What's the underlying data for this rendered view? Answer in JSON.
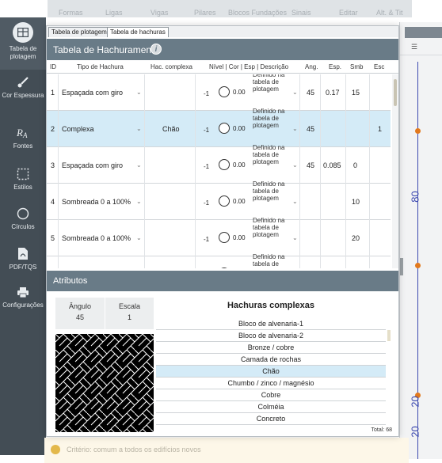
{
  "background": {
    "top_menu": [
      "Formas",
      "Ligas",
      "Vigas",
      "Pilares",
      "Blocos Fundações",
      "Sinais",
      "Editar",
      "Alt. & Tit"
    ],
    "bottom_text": "Critério: comum a todos os edifícios novos"
  },
  "sidebar": {
    "items": [
      {
        "label": "Tabela de plotagem",
        "icon": "table-icon"
      },
      {
        "label": "Cor Espessura",
        "icon": "brush-icon"
      },
      {
        "label": "Fontes",
        "icon": "font-icon"
      },
      {
        "label": "Estilos",
        "icon": "dashed-square-icon"
      },
      {
        "label": "Círculos",
        "icon": "circle-icon"
      },
      {
        "label": "PDF/TQS",
        "icon": "pdf-icon"
      },
      {
        "label": "Configurações",
        "icon": "printer-icon"
      }
    ]
  },
  "tabs": [
    {
      "label": "Tabela de plotagem",
      "active": false
    },
    {
      "label": "Tabela de hachuras",
      "active": true
    }
  ],
  "header": {
    "title": "Tabela de Hachuramento",
    "info_icon": "i"
  },
  "columns": [
    "ID",
    "Tipo de Hachura",
    "Hac. complexa",
    "Nível | Cor | Esp | Descrição",
    "Ang.",
    "Esp.",
    "Smb",
    "Esc"
  ],
  "rows": [
    {
      "id": "1",
      "tipo": "Espaçada com giro",
      "hac": "",
      "nivel": "-1",
      "esp_line": "0.00",
      "desc": "Definido na tabela de plotagem",
      "ang": "45",
      "esp": "0.17",
      "smb": "15",
      "esc": "",
      "selected": false
    },
    {
      "id": "2",
      "tipo": "Complexa",
      "hac": "Chão",
      "nivel": "-1",
      "esp_line": "0.00",
      "desc": "Definido na tabela de plotagem",
      "ang": "45",
      "esp": "",
      "smb": "",
      "esc": "1",
      "selected": true
    },
    {
      "id": "3",
      "tipo": "Espaçada com giro",
      "hac": "",
      "nivel": "-1",
      "esp_line": "0.00",
      "desc": "Definido na tabela de plotagem",
      "ang": "45",
      "esp": "0.085",
      "smb": "0",
      "esc": "",
      "selected": false
    },
    {
      "id": "4",
      "tipo": "Sombreada 0 a 100%",
      "hac": "",
      "nivel": "-1",
      "esp_line": "0.00",
      "desc": "Definido na tabela de plotagem",
      "ang": "",
      "esp": "",
      "smb": "10",
      "esc": "",
      "selected": false
    },
    {
      "id": "5",
      "tipo": "Sombreada 0 a 100%",
      "hac": "",
      "nivel": "-1",
      "esp_line": "0.00",
      "desc": "Definido na tabela de plotagem",
      "ang": "",
      "esp": "",
      "smb": "20",
      "esc": "",
      "selected": false
    },
    {
      "id": "",
      "tipo": "",
      "hac": "",
      "nivel": "",
      "esp_line": "",
      "desc": "Definido na tabela de plotagem",
      "ang": "",
      "esp": "",
      "smb": "",
      "esc": "",
      "selected": false
    }
  ],
  "attributes": {
    "title": "Atributos",
    "angle_label": "Ângulo",
    "angle_value": "45",
    "scale_label": "Escala",
    "scale_value": "1",
    "list_title": "Hachuras complexas",
    "items": [
      "Bloco de alvenaria-1",
      "Bloco de alvenaria-2",
      "Bronze / cobre",
      "Camada de rochas",
      "Chão",
      "Chumbo / zinco / magnésio",
      "Cobre",
      "Colméia",
      "Concreto"
    ],
    "selected_item": "Chão",
    "total": "Total: 68"
  },
  "ruler": {
    "labels": [
      "80",
      "20",
      "20"
    ]
  },
  "colors": {
    "header": "#697b87",
    "sidebar": "#434d55",
    "selection": "#d4ebf7",
    "ruler": "#3c49b0",
    "ruler_marker": "#e2791d"
  }
}
